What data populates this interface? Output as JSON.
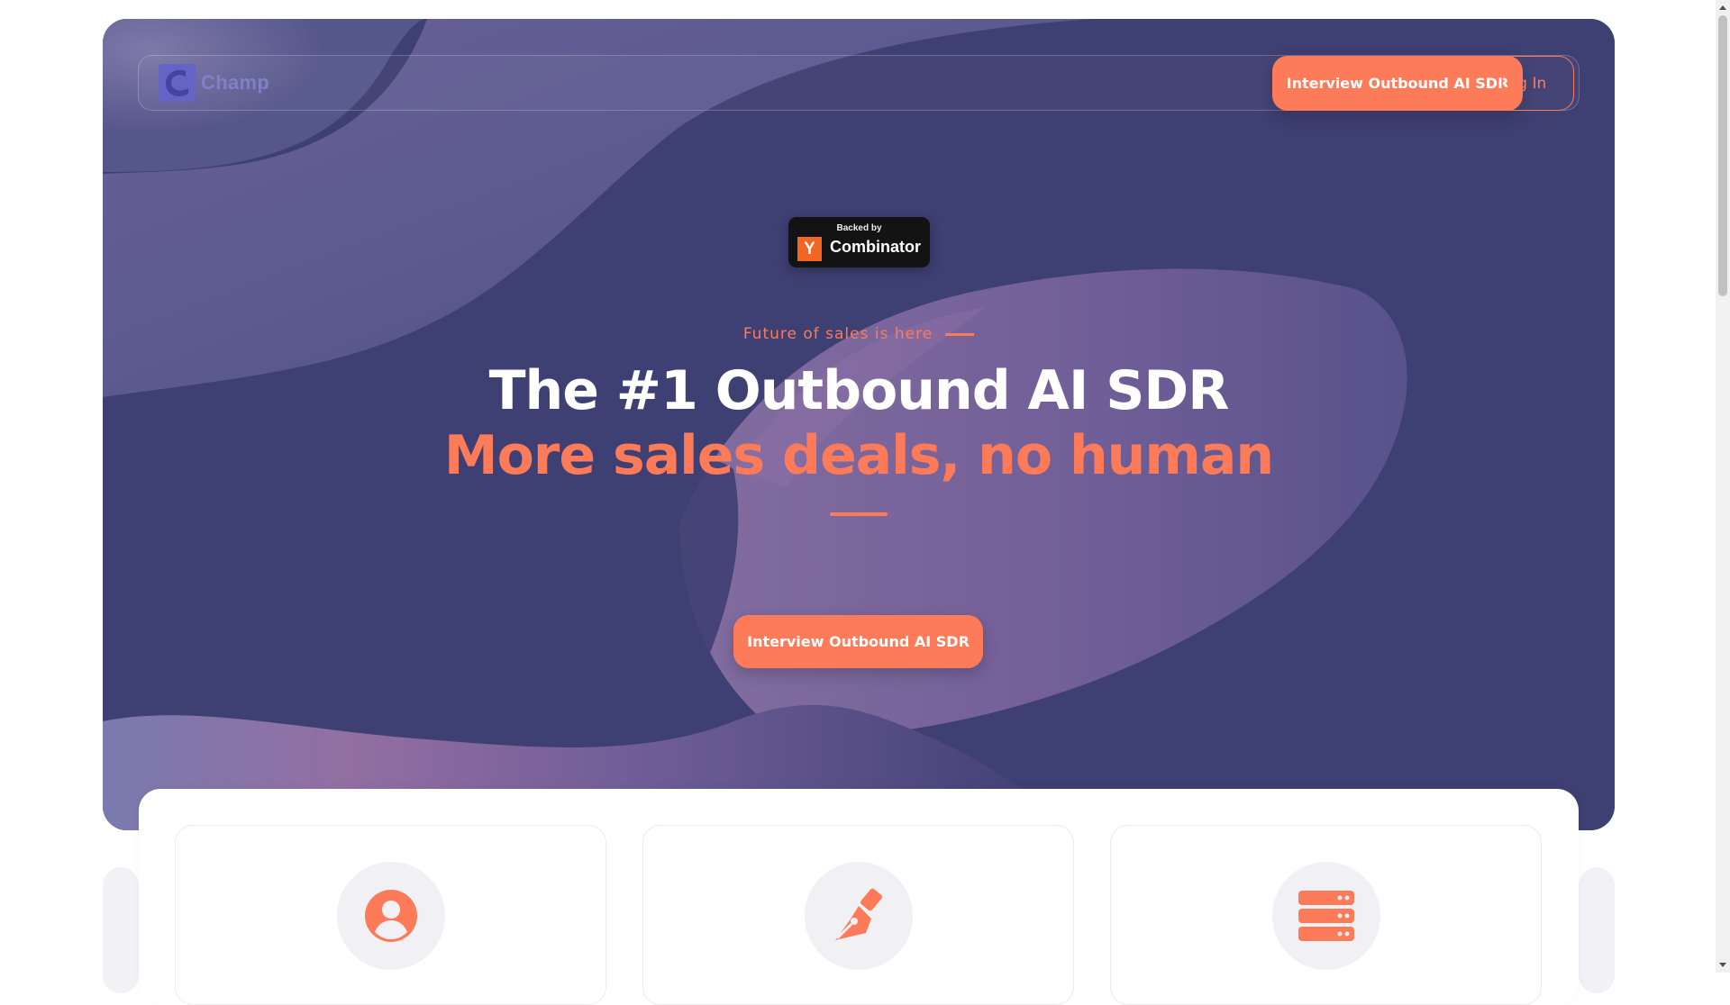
{
  "brand": {
    "name": "Champ",
    "accent_color": "#fe7b59",
    "hero_color": "#3e3f72",
    "logo_color": "#6563c4"
  },
  "nav": {
    "cta_label": "Interview Outbound AI SDR",
    "login_label": "Log In"
  },
  "badge": {
    "backed_by": "Backed by",
    "letter": "Y",
    "name": "Combinator"
  },
  "hero": {
    "eyebrow": "Future of sales is here",
    "title_line1": "The #1 Outbound AI SDR",
    "title_line2": "More sales deals, no human",
    "cta_label": "Interview Outbound AI SDR"
  },
  "features": [
    {
      "icon": "user-icon"
    },
    {
      "icon": "pen-nib-icon"
    },
    {
      "icon": "server-icon"
    }
  ]
}
